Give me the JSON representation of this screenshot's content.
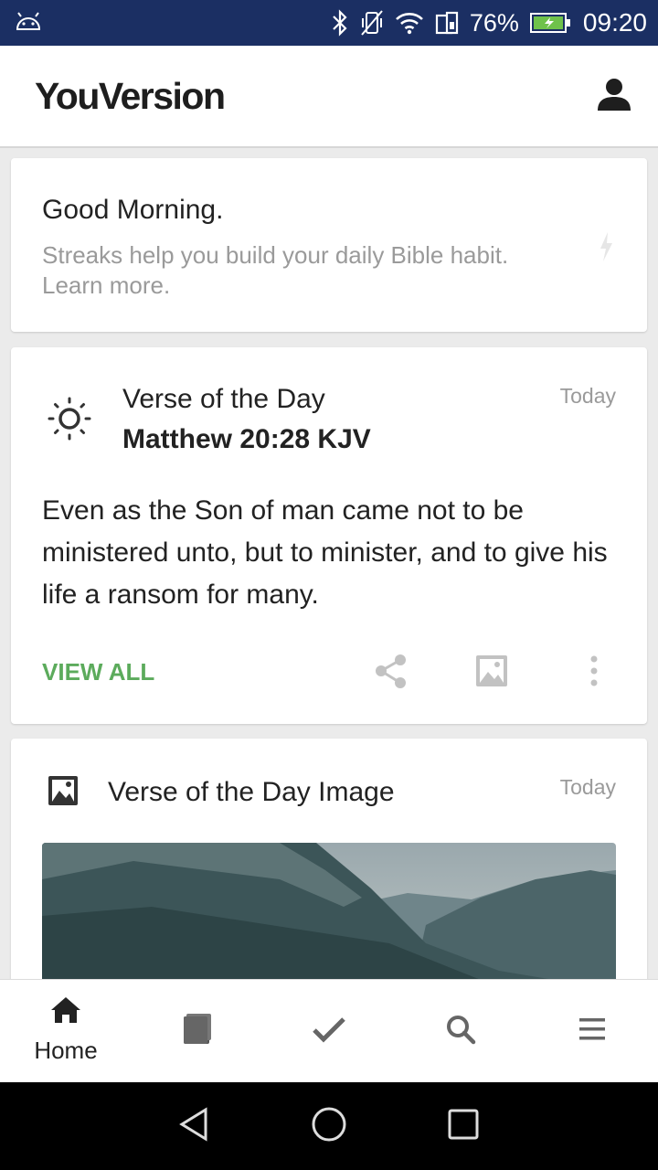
{
  "status_bar": {
    "battery": "76%",
    "time": "09:20"
  },
  "header": {
    "logo": "YouVersion"
  },
  "greeting_card": {
    "title": "Good Morning.",
    "subtitle": "Streaks help you build your daily Bible habit. Learn more."
  },
  "votd_card": {
    "label": "Verse of the Day",
    "reference": "Matthew 20:28 KJV",
    "when": "Today",
    "text": "Even as the Son of man came not to be ministered unto, but to minister, and to give his life a ransom for many.",
    "view_all": "VIEW ALL"
  },
  "image_card": {
    "title": "Verse of the Day Image",
    "when": "Today"
  },
  "tabs": [
    {
      "label": "Home",
      "icon": "home-icon"
    },
    {
      "label": "",
      "icon": "bible-icon"
    },
    {
      "label": "",
      "icon": "checkmark-icon"
    },
    {
      "label": "",
      "icon": "search-icon"
    },
    {
      "label": "",
      "icon": "menu-icon"
    }
  ],
  "colors": {
    "status_bar": "#1b2f63",
    "accent_green": "#5cab5c",
    "muted_text": "#9a9a9a"
  }
}
